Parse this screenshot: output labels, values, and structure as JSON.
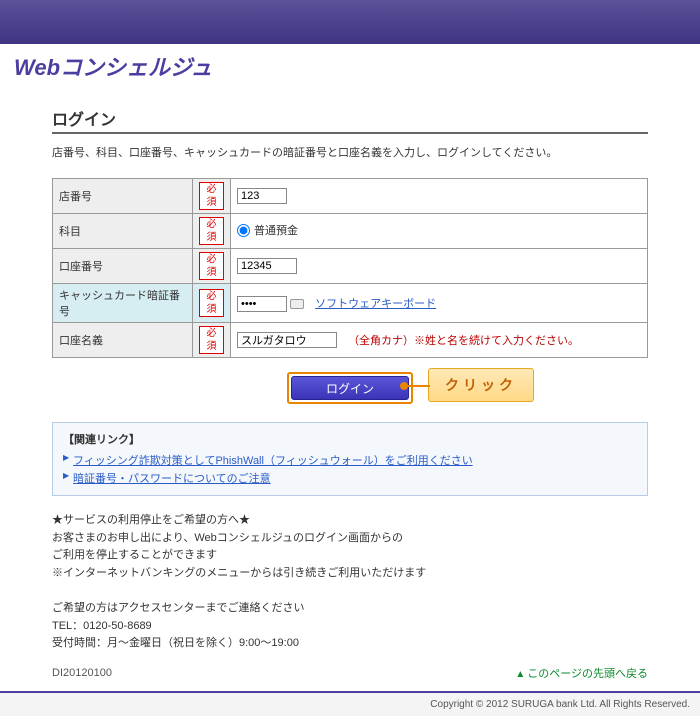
{
  "logo": "Webコンシェルジュ",
  "page_title": "ログイン",
  "instruction": "店番号、科目、口座番号、キャッシュカードの暗証番号と口座名義を入力し、ログインしてください。",
  "required_label": "必須",
  "form": {
    "store_no": {
      "label": "店番号",
      "value": "123"
    },
    "subject": {
      "label": "科目",
      "option": "普通預金"
    },
    "account_no": {
      "label": "口座番号",
      "value": "12345"
    },
    "pin": {
      "label": "キャッシュカード暗証番号",
      "value": "●●●●",
      "swk": "ソフトウェアキーボード"
    },
    "account_name": {
      "label": "口座名義",
      "value": "スルガタロウ",
      "note": "（全角カナ）※姓と名を続けて入力ください。"
    }
  },
  "login_button": "ログイン",
  "click_callout": "クリック",
  "related": {
    "title": "【関連リンク】",
    "links": [
      "フィッシング詐欺対策としてPhishWall（フィッシュウォール）をご利用ください",
      "暗証番号・パスワードについてのご注意"
    ]
  },
  "service_notice": {
    "line1": "★サービスの利用停止をご希望の方へ★",
    "line2": "お客さまのお申し出により、Webコンシェルジュのログイン画面からの",
    "line3": "ご利用を停止することができます",
    "line4": "※インターネットバンキングのメニューからは引き続きご利用いただけます",
    "line5": "ご希望の方はアクセスセンターまでご連絡ください",
    "line6": "TEL：0120-50-8689",
    "line7": "受付時間：月～金曜日（祝日を除く）9:00～19:00"
  },
  "page_id": "DI20120100",
  "back_top": "このページの先頭へ戻る",
  "copyright": "Copyright © 2012 SURUGA bank Ltd. All Rights Reserved."
}
